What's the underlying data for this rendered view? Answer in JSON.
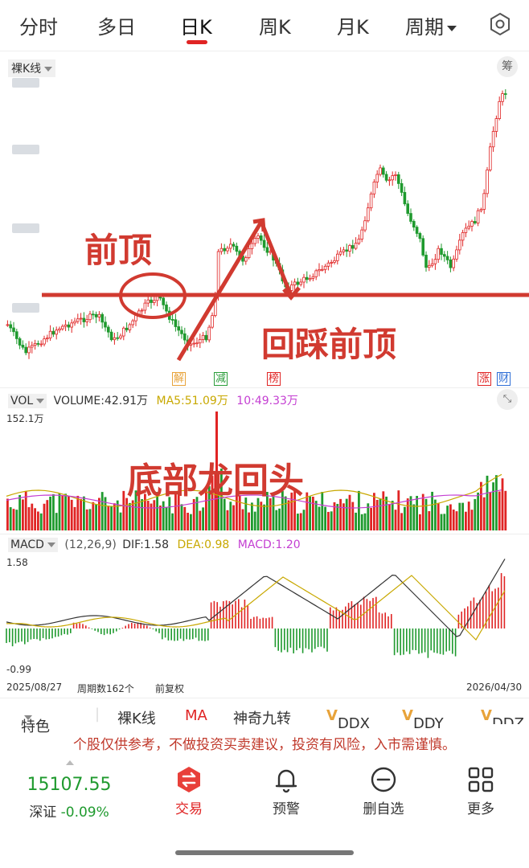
{
  "tabs": [
    "分时",
    "多日",
    "日K",
    "周K",
    "月K",
    "周期"
  ],
  "active_tab": "日K",
  "kline": {
    "type_label": "裸K线",
    "chip_button": "筹",
    "tags": [
      {
        "text": "解",
        "color": "#e8a33a"
      },
      {
        "text": "减",
        "color": "#2a9d3a"
      },
      {
        "text": "榜",
        "color": "#e02424"
      },
      {
        "text": "涨",
        "color": "#e02424"
      },
      {
        "text": "财",
        "color": "#2f6fd6"
      }
    ],
    "annotations": {
      "prev_top": "前顶",
      "pullback": "回踩前顶",
      "dragon": "底部龙回头"
    }
  },
  "volume": {
    "label": "VOL",
    "volume_text": "VOLUME:42.91万",
    "ma5_text": "MA5:51.09万",
    "ma10_text": "10:49.33万",
    "max_label": "152.1万"
  },
  "macd": {
    "label": "MACD",
    "params": "(12,26,9)",
    "dif_text": "DIF:1.58",
    "dea_text": "DEA:0.98",
    "macd_text": "MACD:1.20",
    "max_label": "1.58",
    "min_label": "-0.99"
  },
  "footer_info": {
    "start_date": "2025/08/27",
    "period_count": "周期数162个",
    "adjust": "前复权",
    "end_date": "2026/04/30"
  },
  "toolbar": {
    "feature": "特色",
    "items": [
      "裸K线",
      "MA",
      "神奇九转",
      "DDX",
      "DDY",
      "DDZ"
    ]
  },
  "disclaimer": "个股仅供参考，不做投资买卖建议，投资有风险，入市需谨慎。",
  "index": {
    "value": "15107.55",
    "name": "深证",
    "change": "-0.09%"
  },
  "nav": [
    "交易",
    "预警",
    "删自选",
    "更多"
  ],
  "colors": {
    "up": "#e02424",
    "down": "#1f9a2e",
    "annotation": "#d13a30",
    "ma5": "#c8a800",
    "ma10": "#c43fd2"
  }
}
